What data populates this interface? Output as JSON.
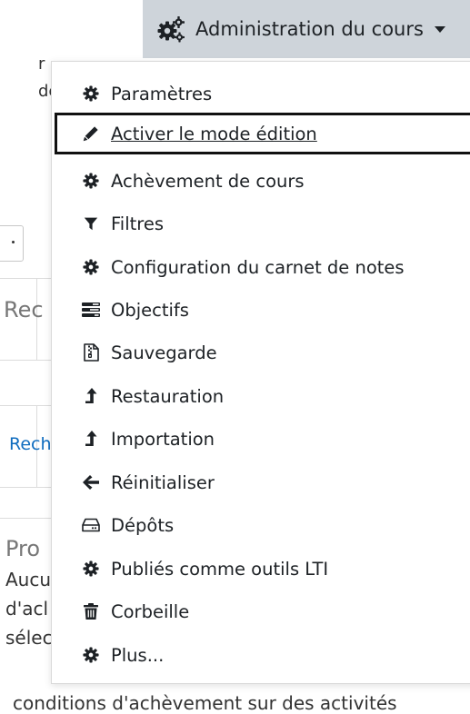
{
  "background": {
    "fragment_top_1": "r",
    "fragment_top_2": "de",
    "fragment_rec": "Rec",
    "fragment_rech": "Rech",
    "fragment_pro": "Pro",
    "fragment_aucu": "Aucu",
    "fragment_dach": "d'acl",
    "fragment_selec": "sélec",
    "fragment_bottom": "conditions d'achèvement sur des activités"
  },
  "admin_menu": {
    "button_label": "Administration du cours",
    "button_icon": "cogs-icon",
    "items": [
      {
        "label": "Paramètres",
        "icon": "cog-icon"
      },
      {
        "label": "Activer le mode édition",
        "icon": "pencil-icon",
        "focused": true
      },
      {
        "label": "Achèvement de cours",
        "icon": "cog-icon"
      },
      {
        "label": "Filtres",
        "icon": "filter-icon"
      },
      {
        "label": "Configuration du carnet de notes",
        "icon": "cog-icon"
      },
      {
        "label": "Objectifs",
        "icon": "tasks-icon"
      },
      {
        "label": "Sauvegarde",
        "icon": "file-archive-icon"
      },
      {
        "label": "Restauration",
        "icon": "level-up-icon"
      },
      {
        "label": "Importation",
        "icon": "level-up-icon"
      },
      {
        "label": "Réinitialiser",
        "icon": "arrow-left-icon"
      },
      {
        "label": "Dépôts",
        "icon": "hdd-icon"
      },
      {
        "label": "Publiés comme outils LTI",
        "icon": "cog-icon"
      },
      {
        "label": "Corbeille",
        "icon": "trash-icon"
      },
      {
        "label": "Plus...",
        "icon": "cog-icon"
      }
    ]
  },
  "colors": {
    "button_bg": "#ced4da",
    "text": "#1d2125",
    "link": "#0f6cbf",
    "focus_border": "#111111"
  }
}
